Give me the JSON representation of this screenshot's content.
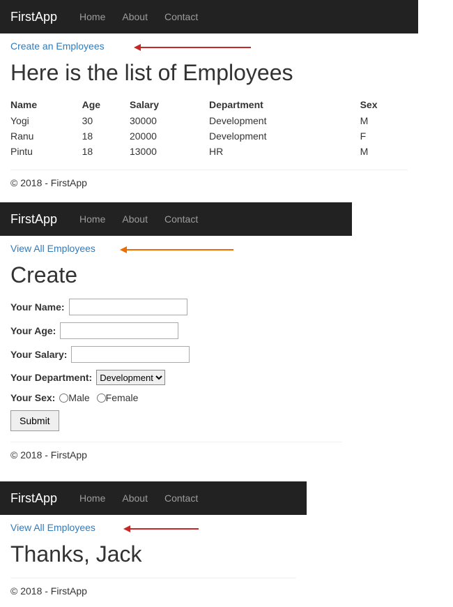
{
  "brand": "FirstApp",
  "nav": {
    "home": "Home",
    "about": "About",
    "contact": "Contact"
  },
  "footer": "© 2018 - FirstApp",
  "shot1": {
    "link": "Create an Employees",
    "heading": "Here is the list of Employees",
    "columns": {
      "name": "Name",
      "age": "Age",
      "salary": "Salary",
      "department": "Department",
      "sex": "Sex"
    },
    "rows": [
      {
        "name": "Yogi",
        "age": "30",
        "salary": "30000",
        "department": "Development",
        "sex": "M"
      },
      {
        "name": "Ranu",
        "age": "18",
        "salary": "20000",
        "department": "Development",
        "sex": "F"
      },
      {
        "name": "Pintu",
        "age": "18",
        "salary": "13000",
        "department": "HR",
        "sex": "M"
      }
    ]
  },
  "shot2": {
    "link": "View All Employees",
    "heading": "Create",
    "labels": {
      "name": "Your Name:",
      "age": "Your Age:",
      "salary": "Your Salary:",
      "department": "Your Department:",
      "sex": "Your Sex:"
    },
    "dept_selected": "Development",
    "sex_options": {
      "male": "Male",
      "female": "Female"
    },
    "submit": "Submit"
  },
  "shot3": {
    "link": "View All Employees",
    "heading": "Thanks, Jack"
  }
}
